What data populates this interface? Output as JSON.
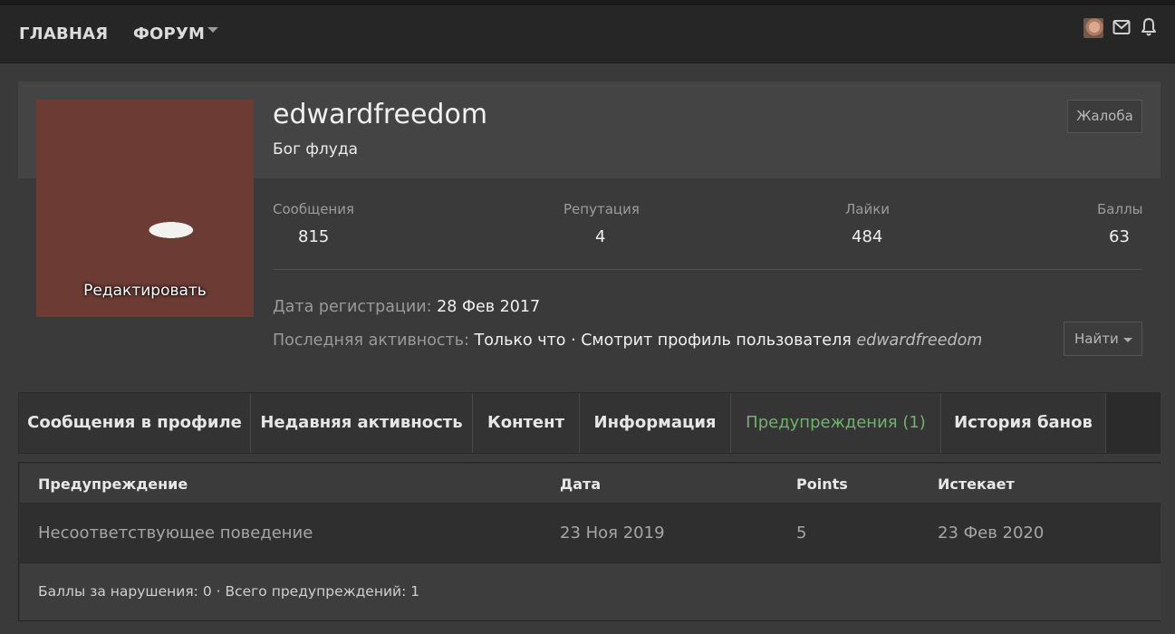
{
  "nav": {
    "home_label": "ГЛАВНАЯ",
    "forum_label": "ФОРУМ"
  },
  "profile": {
    "username": "edwardfreedom",
    "user_title": "Бог флуда",
    "edit_avatar_label": "Редактировать",
    "report_button": "Жалоба",
    "find_button": "Найти",
    "stats": [
      {
        "label": "Сообщения",
        "value": "815"
      },
      {
        "label": "Репутация",
        "value": "4"
      },
      {
        "label": "Лайки",
        "value": "484"
      },
      {
        "label": "Баллы",
        "value": "63"
      }
    ],
    "registered": {
      "label": "Дата регистрации:",
      "value": "28 Фев 2017"
    },
    "last_activity": {
      "label": "Последняя активность:",
      "value": "Только что · Смотрит профиль пользователя",
      "target": "edwardfreedom"
    }
  },
  "tabs": [
    {
      "label": "Сообщения в профиле"
    },
    {
      "label": "Недавняя активность"
    },
    {
      "label": "Контент"
    },
    {
      "label": "Информация"
    },
    {
      "label": "Предупреждения (1)",
      "active": true
    },
    {
      "label": "История банов"
    }
  ],
  "warnings": {
    "columns": [
      "Предупреждение",
      "Дата",
      "Points",
      "Истекает"
    ],
    "rows": [
      [
        "Несоответствующее поведение",
        "23 Ноя 2019",
        "5",
        "23 Фев 2020"
      ]
    ],
    "footer": "Баллы за нарушения: 0 · Всего предупреждений: 1"
  },
  "colors": {
    "accent_active_tab": "#6fb36c",
    "background": "#3a3a3a",
    "topbar": "#262626"
  },
  "icons": [
    "avatar-icon",
    "mail-icon",
    "bell-icon",
    "chevron-down-icon"
  ]
}
